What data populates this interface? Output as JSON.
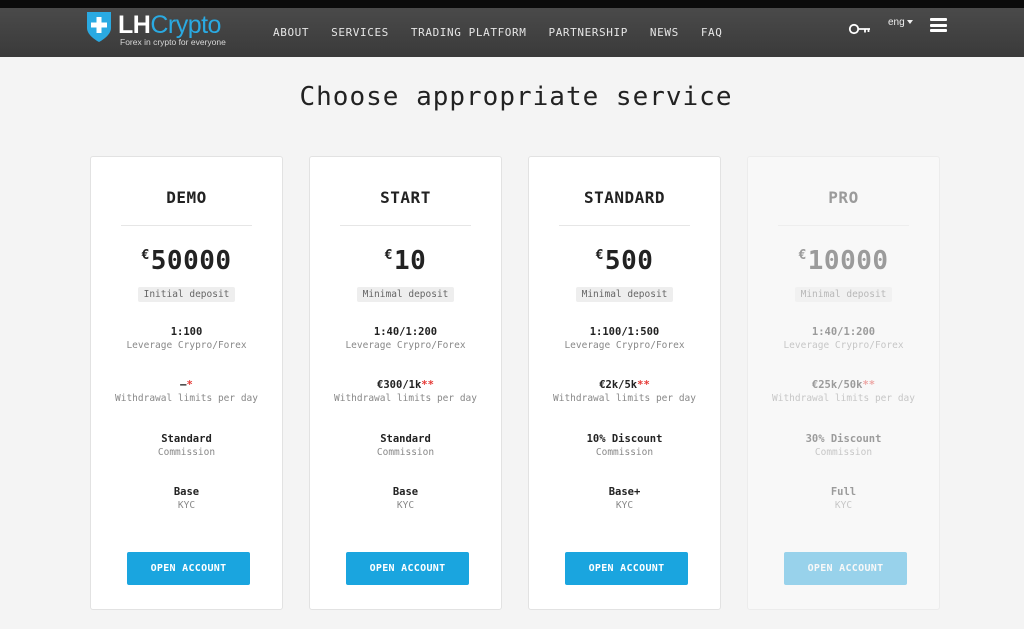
{
  "header": {
    "brand_lh": "LH",
    "brand_crypto": "Crypto",
    "tagline": "Forex in crypto for everyone",
    "nav": [
      "ABOUT",
      "SERVICES",
      "TRADING PLATFORM",
      "PARTNERSHIP",
      "NEWS",
      "FAQ"
    ],
    "language": "eng",
    "icons": [
      "shield-plus-icon",
      "key-icon",
      "caret-down-icon",
      "menu-icon"
    ]
  },
  "page_title": "Choose appropriate service",
  "plans": [
    {
      "name": "DEMO",
      "currency": "€",
      "amount": "50000",
      "deposit_label": "Initial deposit",
      "leverage_value": "1:100",
      "leverage_label": "Leverage Crypro/Forex",
      "withdrawal_value": "–",
      "withdrawal_mark": "*",
      "withdrawal_label": "Withdrawal limits per day",
      "commission_value": "Standard",
      "commission_label": "Commission",
      "kyc_value": "Base",
      "kyc_label": "KYC",
      "button": "OPEN ACCOUNT"
    },
    {
      "name": "START",
      "currency": "€",
      "amount": "10",
      "deposit_label": "Minimal deposit",
      "leverage_value": "1:40/1:200",
      "leverage_label": "Leverage Crypro/Forex",
      "withdrawal_value": "€300/1k",
      "withdrawal_mark": "**",
      "withdrawal_label": "Withdrawal limits per day",
      "commission_value": "Standard",
      "commission_label": "Commission",
      "kyc_value": "Base",
      "kyc_label": "KYC",
      "button": "OPEN ACCOUNT"
    },
    {
      "name": "STANDARD",
      "currency": "€",
      "amount": "500",
      "deposit_label": "Minimal deposit",
      "leverage_value": "1:100/1:500",
      "leverage_label": "Leverage Crypro/Forex",
      "withdrawal_value": "€2k/5k",
      "withdrawal_mark": "**",
      "withdrawal_label": "Withdrawal limits per day",
      "commission_value": "10% Discount",
      "commission_label": "Commission",
      "kyc_value": "Base+",
      "kyc_label": "KYC",
      "button": "OPEN ACCOUNT"
    },
    {
      "name": "PRO",
      "currency": "€",
      "amount": "10000",
      "deposit_label": "Minimal deposit",
      "leverage_value": "1:40/1:200",
      "leverage_label": "Leverage Crypro/Forex",
      "withdrawal_value": "€25k/50k",
      "withdrawal_mark": "**",
      "withdrawal_label": "Withdrawal limits per day",
      "commission_value": "30% Discount",
      "commission_label": "Commission",
      "kyc_value": "Full",
      "kyc_label": "KYC",
      "button": "OPEN ACCOUNT"
    }
  ],
  "colors": {
    "accent": "#1aa5df",
    "header_bg": "#404040",
    "page_bg": "#f4f4f4",
    "asterisk": "#e53935"
  }
}
